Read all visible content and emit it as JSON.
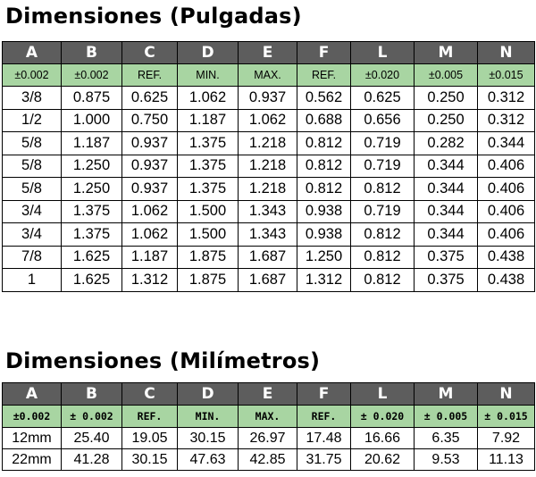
{
  "title_inches": "Dimensiones (Pulgadas)",
  "title_mm": "Dimensiones (Milímetros)",
  "columns": [
    "A",
    "B",
    "C",
    "D",
    "E",
    "F",
    "L",
    "M",
    "N"
  ],
  "subheaders_inches": [
    "±0.002",
    "±0.002",
    "REF.",
    "MIN.",
    "MAX.",
    "REF.",
    "±0.020",
    "±0.005",
    "±0.015"
  ],
  "subheaders_mm": [
    "±0.002",
    "± 0.002",
    "REF.",
    "MIN.",
    "MAX.",
    "REF.",
    "± 0.020",
    "± 0.005",
    "± 0.015"
  ],
  "rows_inches": [
    [
      "3/8",
      "0.875",
      "0.625",
      "1.062",
      "0.937",
      "0.562",
      "0.625",
      "0.250",
      "0.312"
    ],
    [
      "1/2",
      "1.000",
      "0.750",
      "1.187",
      "1.062",
      "0.688",
      "0.656",
      "0.250",
      "0.312"
    ],
    [
      "5/8",
      "1.187",
      "0.937",
      "1.375",
      "1.218",
      "0.812",
      "0.719",
      "0.282",
      "0.344"
    ],
    [
      "5/8",
      "1.250",
      "0.937",
      "1.375",
      "1.218",
      "0.812",
      "0.719",
      "0.344",
      "0.406"
    ],
    [
      "5/8",
      "1.250",
      "0.937",
      "1.375",
      "1.218",
      "0.812",
      "0.812",
      "0.344",
      "0.406"
    ],
    [
      "3/4",
      "1.375",
      "1.062",
      "1.500",
      "1.343",
      "0.938",
      "0.719",
      "0.344",
      "0.406"
    ],
    [
      "3/4",
      "1.375",
      "1.062",
      "1.500",
      "1.343",
      "0.938",
      "0.812",
      "0.344",
      "0.406"
    ],
    [
      "7/8",
      "1.625",
      "1.187",
      "1.875",
      "1.687",
      "1.250",
      "0.812",
      "0.375",
      "0.438"
    ],
    [
      "1",
      "1.625",
      "1.312",
      "1.875",
      "1.687",
      "1.312",
      "0.812",
      "0.375",
      "0.438"
    ]
  ],
  "rows_mm": [
    [
      "12mm",
      "25.40",
      "19.05",
      "30.15",
      "26.97",
      "17.48",
      "16.66",
      "6.35",
      "7.92"
    ],
    [
      "22mm",
      "41.28",
      "30.15",
      "47.63",
      "42.85",
      "31.75",
      "20.62",
      "9.53",
      "11.13"
    ]
  ],
  "colors": {
    "header_bg": "#5d5d5d",
    "subheader_bg": "#a8d5a2"
  }
}
